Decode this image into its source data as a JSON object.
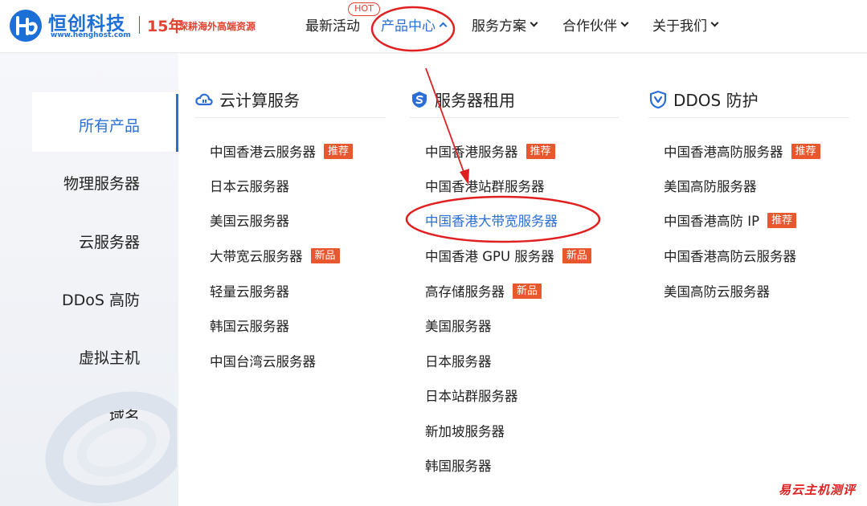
{
  "header": {
    "logo_name": "恒创科技",
    "logo_url": "www.henghost.com",
    "logo_years": "15年",
    "logo_slogan": "深耕海外高端资源",
    "hot_badge": "HOT",
    "nav": [
      {
        "label": "最新活动"
      },
      {
        "label": "产品中心"
      },
      {
        "label": "服务方案"
      },
      {
        "label": "合作伙伴"
      },
      {
        "label": "关于我们"
      }
    ]
  },
  "sidebar": {
    "items": [
      {
        "label": "所有产品"
      },
      {
        "label": "物理服务器"
      },
      {
        "label": "云服务器"
      },
      {
        "label": "DDoS 高防"
      },
      {
        "label": "虚拟主机"
      },
      {
        "label": "域名"
      }
    ]
  },
  "menu": {
    "columns": [
      {
        "title": "云计算服务",
        "icon": "cloud-icon",
        "items": [
          {
            "label": "中国香港云服务器",
            "tag": "推荐"
          },
          {
            "label": "日本云服务器",
            "tag": ""
          },
          {
            "label": "美国云服务器",
            "tag": ""
          },
          {
            "label": "大带宽云服务器",
            "tag": "新品"
          },
          {
            "label": "轻量云服务器",
            "tag": ""
          },
          {
            "label": "韩国云服务器",
            "tag": ""
          },
          {
            "label": "中国台湾云服务器",
            "tag": ""
          }
        ]
      },
      {
        "title": "服务器租用",
        "icon": "server-shield-icon",
        "items": [
          {
            "label": "中国香港服务器",
            "tag": "推荐"
          },
          {
            "label": "中国香港站群服务器",
            "tag": ""
          },
          {
            "label": "中国香港大带宽服务器",
            "tag": ""
          },
          {
            "label": "中国香港 GPU 服务器",
            "tag": "新品"
          },
          {
            "label": "高存储服务器",
            "tag": "新品"
          },
          {
            "label": "美国服务器",
            "tag": ""
          },
          {
            "label": "日本服务器",
            "tag": ""
          },
          {
            "label": "日本站群服务器",
            "tag": ""
          },
          {
            "label": "新加坡服务器",
            "tag": ""
          },
          {
            "label": "韩国服务器",
            "tag": ""
          }
        ]
      },
      {
        "title": "DDOS 防护",
        "icon": "shield-icon",
        "items": [
          {
            "label": "中国香港高防服务器",
            "tag": "推荐"
          },
          {
            "label": "美国高防服务器",
            "tag": ""
          },
          {
            "label": "中国香港高防 IP",
            "tag": "推荐"
          },
          {
            "label": "中国香港高防云服务器",
            "tag": ""
          },
          {
            "label": "美国高防云服务器",
            "tag": ""
          }
        ]
      }
    ]
  },
  "watermark": "易云主机测评",
  "colors": {
    "accent": "#2b6fd6",
    "tag_bg": "#e9572f",
    "annotation": "#e02020"
  }
}
